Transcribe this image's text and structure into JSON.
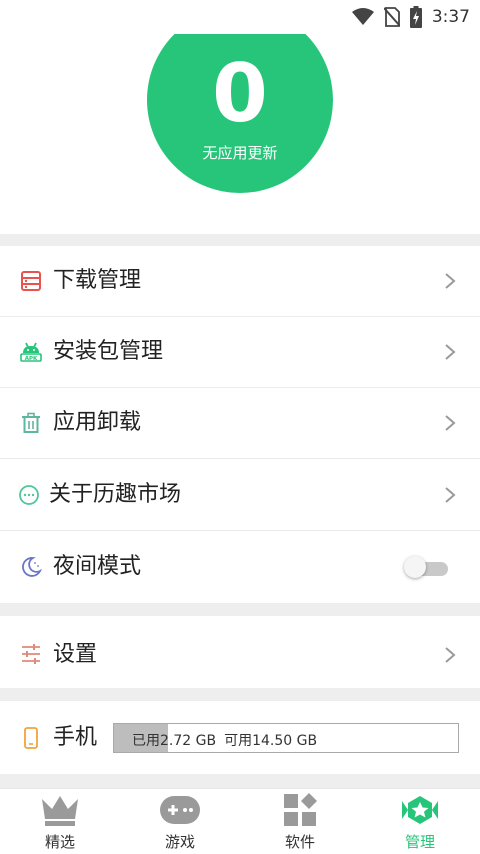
{
  "status_bar": {
    "time": "3:37",
    "icons": [
      "wifi-icon",
      "no-sim-icon",
      "battery-charging-icon"
    ]
  },
  "hero": {
    "count": "0",
    "subtitle": "无应用更新",
    "color": "#27c57a"
  },
  "menu": {
    "download": {
      "label": "下载管理",
      "icon": "download-list-icon"
    },
    "apk": {
      "label": "安装包管理",
      "icon": "android-apk-icon"
    },
    "uninstall": {
      "label": "应用卸载",
      "icon": "trash-icon"
    },
    "about": {
      "label": "关于历趣市场",
      "icon": "chat-bubble-icon"
    },
    "night": {
      "label": "夜间模式",
      "icon": "moon-icon",
      "toggle_on": false
    },
    "settings": {
      "label": "设置",
      "icon": "sliders-icon"
    },
    "phone": {
      "label": "手机",
      "icon": "phone-icon",
      "used_label": "已用2.72 GB",
      "free_label": "可用14.50 GB",
      "used_fraction": 0.158
    }
  },
  "bottom_nav": {
    "featured": {
      "label": "精选",
      "icon": "crown-icon"
    },
    "games": {
      "label": "游戏",
      "icon": "gamepad-icon"
    },
    "software": {
      "label": "软件",
      "icon": "apps-grid-icon"
    },
    "manage": {
      "label": "管理",
      "icon": "star-badge-icon",
      "active": true
    }
  }
}
